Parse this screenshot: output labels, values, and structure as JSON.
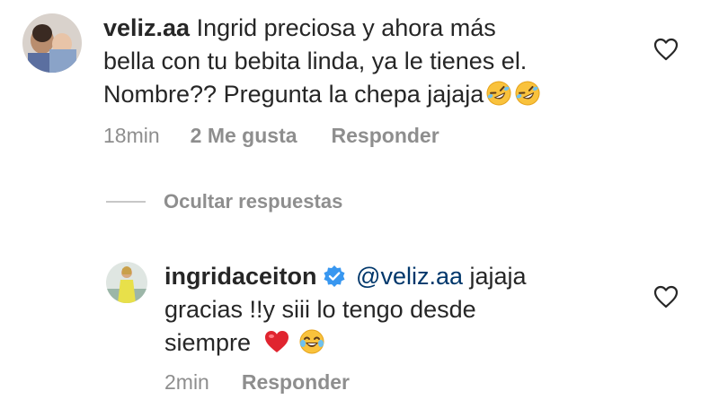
{
  "comments": [
    {
      "username": "veliz.aa",
      "text_line1": "Ingrid preciosa y ahora más",
      "text_line2": "bella con tu bebita linda, ya le tienes el.",
      "text_line3": "Nombre?? Pregunta la chepa jajaja",
      "emojis": [
        "rolling-on-floor-laughing-emoji",
        "rolling-on-floor-laughing-emoji"
      ],
      "time": "18min",
      "likes": "2 Me gusta",
      "reply_label": "Responder"
    }
  ],
  "replies_toggle": {
    "label": "Ocultar respuestas"
  },
  "reply": {
    "username": "ingridaceiton",
    "verified_icon": "verified-badge-icon",
    "mention": "@veliz.aa",
    "text_line1": "jajaja",
    "text_line2": "gracias !!y siii lo tengo desde",
    "text_line3": "siempre",
    "emojis": [
      "red-heart-emoji",
      "face-with-tears-of-joy-emoji"
    ],
    "time": "2min",
    "reply_label": "Responder"
  },
  "colors": {
    "text": "#262626",
    "secondary": "#8e8e8e",
    "mention": "#00376b",
    "verified": "#3897f0",
    "heart_outline": "#262626"
  }
}
